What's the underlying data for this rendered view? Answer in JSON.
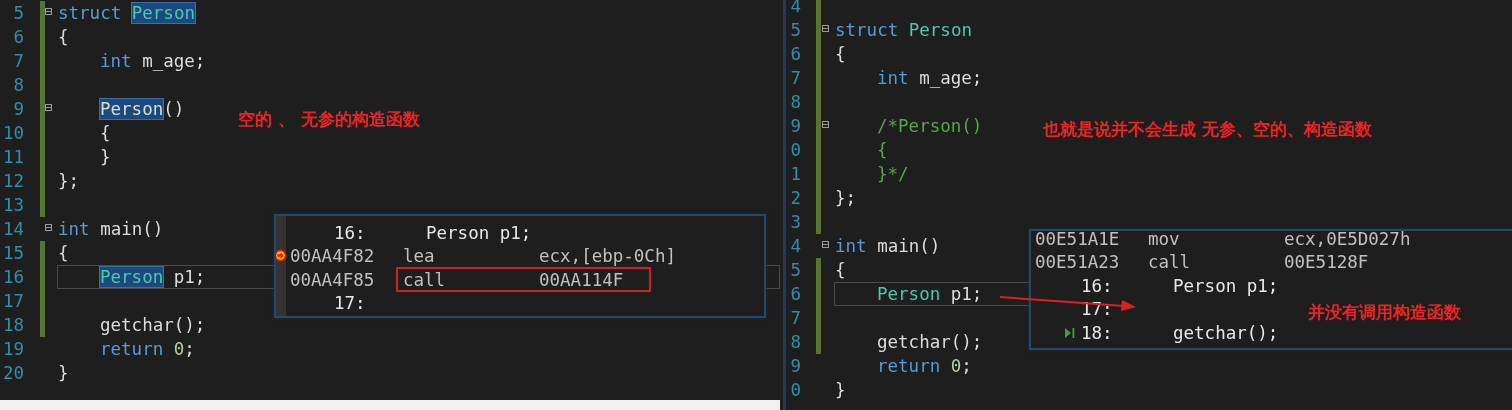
{
  "panes": [
    {
      "lines": [
        {
          "number": "5",
          "fold": true,
          "changed": true,
          "current": false,
          "indented": false,
          "tokens": [
            {
              "kind": "keyword",
              "text": "struct ",
              "highlighted": false
            },
            {
              "kind": "type",
              "text": "Person",
              "highlighted": true
            }
          ]
        },
        {
          "number": "6",
          "fold": false,
          "changed": true,
          "current": false,
          "indented": false,
          "tokens": [
            {
              "kind": "plain",
              "text": "{",
              "highlighted": false
            }
          ]
        },
        {
          "number": "7",
          "fold": false,
          "changed": true,
          "current": false,
          "indented": true,
          "tokens": [
            {
              "kind": "keyword",
              "text": "int",
              "highlighted": false
            },
            {
              "kind": "plain",
              "text": " m_age;",
              "highlighted": false
            }
          ]
        },
        {
          "number": "8",
          "fold": false,
          "changed": true,
          "current": false,
          "indented": false
        },
        {
          "number": "9",
          "fold": true,
          "changed": true,
          "current": false,
          "indented": true,
          "tokens": [
            {
              "kind": "plain",
              "text": "Person",
              "highlighted": true
            },
            {
              "kind": "plain",
              "text": "()",
              "highlighted": false
            }
          ]
        },
        {
          "number": "10",
          "fold": false,
          "changed": true,
          "current": false,
          "indented": true,
          "tokens": [
            {
              "kind": "plain",
              "text": "{",
              "highlighted": false
            }
          ]
        },
        {
          "number": "11",
          "fold": false,
          "changed": true,
          "current": false,
          "indented": true,
          "tokens": [
            {
              "kind": "plain",
              "text": "}",
              "highlighted": false
            }
          ]
        },
        {
          "number": "12",
          "fold": false,
          "changed": true,
          "current": false,
          "indented": false,
          "tokens": [
            {
              "kind": "plain",
              "text": "};",
              "highlighted": false
            }
          ]
        },
        {
          "number": "13",
          "fold": false,
          "changed": true,
          "current": false,
          "indented": false
        },
        {
          "number": "14",
          "fold": true,
          "changed": false,
          "current": false,
          "indented": false,
          "tokens": [
            {
              "kind": "keyword",
              "text": "int",
              "highlighted": false
            },
            {
              "kind": "plain",
              "text": " main()",
              "highlighted": false
            }
          ]
        },
        {
          "number": "15",
          "fold": false,
          "changed": true,
          "current": false,
          "indented": false,
          "tokens": [
            {
              "kind": "plain",
              "text": "{",
              "highlighted": false
            }
          ]
        },
        {
          "number": "16",
          "fold": false,
          "changed": true,
          "current": true,
          "indented": true,
          "tokens": [
            {
              "kind": "type",
              "text": "Person",
              "highlighted": true
            },
            {
              "kind": "plain",
              "text": " p1;",
              "highlighted": false
            }
          ]
        },
        {
          "number": "17",
          "fold": false,
          "changed": true,
          "current": false,
          "indented": false
        },
        {
          "number": "18",
          "fold": false,
          "changed": true,
          "current": false,
          "indented": true,
          "tokens": [
            {
              "kind": "plain",
              "text": "getchar();",
              "highlighted": false
            }
          ]
        },
        {
          "number": "19",
          "fold": false,
          "changed": false,
          "current": false,
          "indented": true,
          "tokens": [
            {
              "kind": "keyword",
              "text": "return ",
              "highlighted": false
            },
            {
              "kind": "number",
              "text": "0",
              "highlighted": false
            },
            {
              "kind": "plain",
              "text": ";",
              "highlighted": false
            }
          ]
        },
        {
          "number": "20",
          "fold": false,
          "changed": false,
          "current": false,
          "indented": false,
          "tokens": [
            {
              "kind": "plain",
              "text": "}",
              "highlighted": false
            }
          ]
        }
      ],
      "annotation": "空的 、 无参的构造函数",
      "popup": {
        "rows": [
          {
            "kind": "source",
            "number": "16:",
            "text": "Person p1;",
            "step": false
          },
          {
            "kind": "instruction",
            "address": "00AA4F82",
            "mnemonic": "lea",
            "operand": "ecx,[ebp-0Ch]",
            "current": true,
            "boxed": false
          },
          {
            "kind": "instruction",
            "address": "00AA4F85",
            "mnemonic": "call",
            "operand": "00AA114F",
            "current": false,
            "boxed": true
          },
          {
            "kind": "source",
            "number": "17:",
            "step": false
          }
        ]
      }
    },
    {
      "lines": [
        {
          "number": "4",
          "fold": false,
          "changed": true,
          "current": false,
          "indented": false
        },
        {
          "number": "5",
          "fold": true,
          "changed": true,
          "current": false,
          "indented": false,
          "tokens": [
            {
              "kind": "keyword",
              "text": "struct ",
              "highlighted": false
            },
            {
              "kind": "type",
              "text": "Person",
              "highlighted": false
            }
          ]
        },
        {
          "number": "6",
          "fold": false,
          "changed": true,
          "current": false,
          "indented": false,
          "tokens": [
            {
              "kind": "plain",
              "text": "{",
              "highlighted": false
            }
          ]
        },
        {
          "number": "7",
          "fold": false,
          "changed": true,
          "current": false,
          "indented": true,
          "tokens": [
            {
              "kind": "keyword",
              "text": "int",
              "highlighted": false
            },
            {
              "kind": "plain",
              "text": " m_age;",
              "highlighted": false
            }
          ]
        },
        {
          "number": "8",
          "fold": false,
          "changed": true,
          "current": false,
          "indented": false
        },
        {
          "number": "9",
          "fold": true,
          "changed": true,
          "current": false,
          "indented": true,
          "tokens": [
            {
              "kind": "comment",
              "text": "/*Person()",
              "highlighted": false
            }
          ]
        },
        {
          "number": "0",
          "fold": false,
          "changed": true,
          "current": false,
          "indented": true,
          "tokens": [
            {
              "kind": "comment",
              "text": "{",
              "highlighted": false
            }
          ]
        },
        {
          "number": "1",
          "fold": false,
          "changed": true,
          "current": false,
          "indented": true,
          "tokens": [
            {
              "kind": "comment",
              "text": "}*/",
              "highlighted": false
            }
          ]
        },
        {
          "number": "2",
          "fold": false,
          "changed": true,
          "current": false,
          "indented": false,
          "tokens": [
            {
              "kind": "plain",
              "text": "};",
              "highlighted": false
            }
          ]
        },
        {
          "number": "3",
          "fold": false,
          "changed": true,
          "current": false,
          "indented": false
        },
        {
          "number": "4",
          "fold": true,
          "changed": false,
          "current": false,
          "indented": false,
          "tokens": [
            {
              "kind": "keyword",
              "text": "int",
              "highlighted": false
            },
            {
              "kind": "plain",
              "text": " main()",
              "highlighted": false
            }
          ]
        },
        {
          "number": "5",
          "fold": false,
          "changed": true,
          "current": false,
          "indented": false,
          "tokens": [
            {
              "kind": "plain",
              "text": "{",
              "highlighted": false
            }
          ]
        },
        {
          "number": "6",
          "fold": false,
          "changed": true,
          "current": true,
          "indented": true,
          "tokens": [
            {
              "kind": "type",
              "text": "Person",
              "highlighted": false
            },
            {
              "kind": "plain",
              "text": " p1;",
              "highlighted": false
            }
          ]
        },
        {
          "number": "7",
          "fold": false,
          "changed": true,
          "current": false,
          "indented": false
        },
        {
          "number": "8",
          "fold": false,
          "changed": true,
          "current": false,
          "indented": true,
          "tokens": [
            {
              "kind": "plain",
              "text": "getchar();",
              "highlighted": false
            }
          ]
        },
        {
          "number": "9",
          "fold": false,
          "changed": false,
          "current": false,
          "indented": true,
          "tokens": [
            {
              "kind": "keyword",
              "text": "return ",
              "highlighted": false
            },
            {
              "kind": "number",
              "text": "0",
              "highlighted": false
            },
            {
              "kind": "plain",
              "text": ";",
              "highlighted": false
            }
          ]
        },
        {
          "number": "0",
          "fold": false,
          "changed": false,
          "current": false,
          "indented": false,
          "tokens": [
            {
              "kind": "plain",
              "text": "}",
              "highlighted": false
            }
          ]
        }
      ],
      "annotation": "也就是说并不会生成 无参、空的、构造函数",
      "popup": {
        "rows": [
          {
            "kind": "instruction",
            "address": "00E51A1E",
            "mnemonic": "mov",
            "operand": "ecx,0E5D027h",
            "current": false,
            "boxed": false
          },
          {
            "kind": "instruction",
            "address": "00E51A23",
            "mnemonic": "call",
            "operand": "00E5128F",
            "current": false,
            "boxed": false
          },
          {
            "kind": "source",
            "number": "16:",
            "text": "Person p1;",
            "step": false
          },
          {
            "kind": "source",
            "number": "17:",
            "step": false
          },
          {
            "kind": "source",
            "number": "18:",
            "text": "getchar();",
            "step": true
          }
        ],
        "note": "并没有调用构造函数"
      }
    }
  ]
}
